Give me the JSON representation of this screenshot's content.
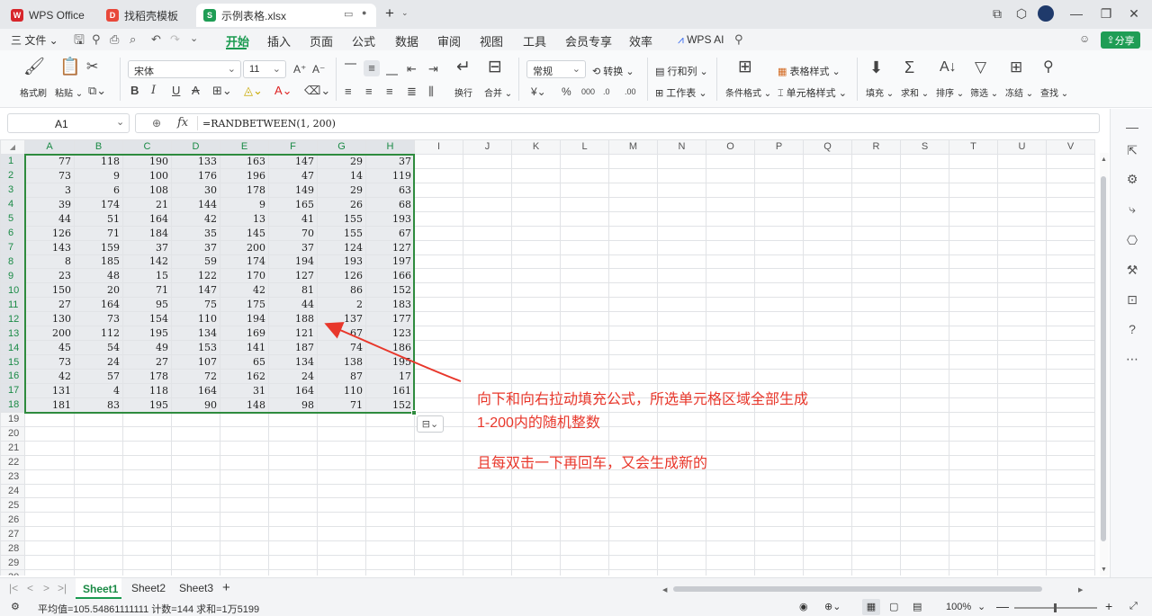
{
  "titlebar": {
    "tabs": [
      {
        "label": "WPS Office",
        "icon": "wps-logo-icon",
        "color": "#d7262b"
      },
      {
        "label": "找稻壳模板",
        "icon": "docer-icon",
        "color": "#e8483a"
      },
      {
        "label": "示例表格.xlsx",
        "icon": "spreadsheet-icon",
        "color": "#1f9d55"
      }
    ],
    "new_tab": "+"
  },
  "menubar": {
    "file": "三 文件 ⌄",
    "items": [
      "开始",
      "插入",
      "页面",
      "公式",
      "数据",
      "审阅",
      "视图",
      "工具",
      "会员专享",
      "效率"
    ],
    "active": "开始",
    "wps_ai": "WPS AI",
    "share": "分享"
  },
  "ribbon": {
    "format_painter": "格式刷",
    "paste": "粘贴",
    "font_name": "宋体",
    "font_size": "11",
    "wrap": "换行",
    "merge": "合并",
    "number_format": "常规",
    "convert": "转换",
    "row_col": "行和列",
    "worksheet": "工作表",
    "cond_format": "条件格式",
    "table_style": "表格样式",
    "cell_style": "单元格样式",
    "fill": "填充",
    "sum": "求和",
    "sort": "排序",
    "filter": "筛选",
    "freeze": "冻结",
    "find": "查找"
  },
  "formula": {
    "name_box": "A1",
    "fx": "fx",
    "content": "=RANDBETWEEN(1, 200)"
  },
  "columns": [
    "A",
    "B",
    "C",
    "D",
    "E",
    "F",
    "G",
    "H",
    "I",
    "J",
    "K",
    "L",
    "M",
    "N",
    "O",
    "P",
    "Q",
    "R",
    "S",
    "T",
    "U",
    "V"
  ],
  "rows": [
    [
      77,
      118,
      190,
      133,
      163,
      147,
      29,
      37
    ],
    [
      73,
      9,
      100,
      176,
      196,
      47,
      14,
      119
    ],
    [
      3,
      6,
      108,
      30,
      178,
      149,
      29,
      63
    ],
    [
      39,
      174,
      21,
      144,
      9,
      165,
      26,
      68
    ],
    [
      44,
      51,
      164,
      42,
      13,
      41,
      155,
      193
    ],
    [
      126,
      71,
      184,
      35,
      145,
      70,
      155,
      67
    ],
    [
      143,
      159,
      37,
      37,
      200,
      37,
      124,
      127
    ],
    [
      8,
      185,
      142,
      59,
      174,
      194,
      193,
      197
    ],
    [
      23,
      48,
      15,
      122,
      170,
      127,
      126,
      166
    ],
    [
      150,
      20,
      71,
      147,
      42,
      81,
      86,
      152
    ],
    [
      27,
      164,
      95,
      75,
      175,
      44,
      2,
      183
    ],
    [
      130,
      73,
      154,
      110,
      194,
      188,
      137,
      177
    ],
    [
      200,
      112,
      195,
      134,
      169,
      121,
      67,
      123
    ],
    [
      45,
      54,
      49,
      153,
      141,
      187,
      74,
      186
    ],
    [
      73,
      24,
      27,
      107,
      65,
      134,
      138,
      195
    ],
    [
      42,
      57,
      178,
      72,
      162,
      24,
      87,
      17
    ],
    [
      131,
      4,
      118,
      164,
      31,
      164,
      110,
      161
    ],
    [
      181,
      83,
      195,
      90,
      148,
      98,
      71,
      152
    ]
  ],
  "total_rows": 30,
  "annotation": {
    "line1": "向下和向右拉动填充公式，所选单元格区域全部生成",
    "line2": "1-200内的随机整数",
    "line3": "且每双击一下再回车，又会生成新的",
    "color": "#e8372b"
  },
  "sheets": [
    "Sheet1",
    "Sheet2",
    "Sheet3"
  ],
  "active_sheet": "Sheet1",
  "status": {
    "summary": "平均值=105.54861111111  计数=144  求和=1万5199",
    "zoom": "100%"
  }
}
